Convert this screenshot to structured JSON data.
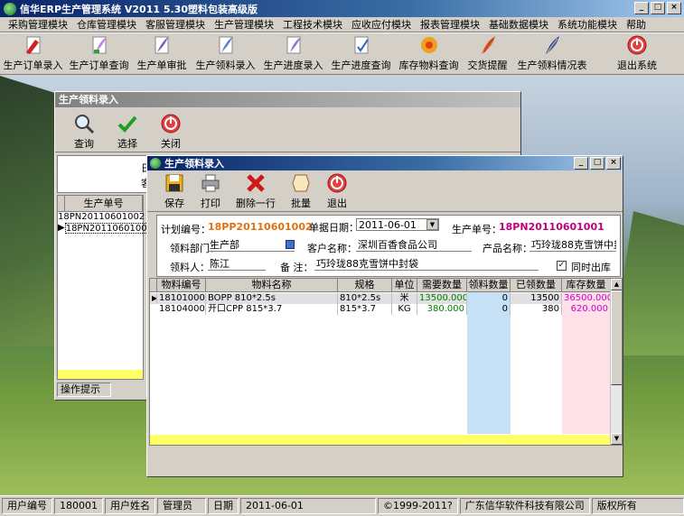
{
  "app": {
    "title": "信华ERP生产管理系统  V2011  5.30塑料包装高级版",
    "window_buttons": [
      "_",
      "□",
      "×"
    ]
  },
  "menu": [
    "采购管理模块",
    "仓库管理模块",
    "客服管理模块",
    "生产管理模块",
    "工程技术模块",
    "应收应付模块",
    "报表管理模块",
    "基础数据模块",
    "系统功能模块",
    "帮助"
  ],
  "toolbar": [
    {
      "label": "生产订单录入",
      "icon": "pen-doc-icon"
    },
    {
      "label": "生产订单查询",
      "icon": "feather-doc-icon"
    },
    {
      "label": "生产单审批",
      "icon": "quill-doc-icon"
    },
    {
      "label": "生产领料录入",
      "icon": "quill-doc-icon"
    },
    {
      "label": "生产进度录入",
      "icon": "feather-doc-icon"
    },
    {
      "label": "生产进度查询",
      "icon": "check-doc-icon"
    },
    {
      "label": "库存物料查询",
      "icon": "flower-icon"
    },
    {
      "label": "交货提醒",
      "icon": "quill-icon"
    },
    {
      "label": "生产领料情况表",
      "icon": "blue-feather-icon"
    },
    {
      "label": "退出系统",
      "icon": "exit-icon"
    }
  ],
  "bg_window": {
    "title": "生产领料录入",
    "tools": [
      "查询",
      "选择",
      "关闭"
    ],
    "list_header": "生产单号",
    "rows": [
      "18PN20110601002",
      "18PN20110601001"
    ],
    "hint": "操作提示",
    "partial_text_1": "日",
    "partial_text_2": "客"
  },
  "main_window": {
    "title": "生产领料录入",
    "tools": [
      "保存",
      "打印",
      "删除一行",
      "批量",
      "退出"
    ],
    "form": {
      "plan_no_label": "计划编号：",
      "plan_no": "18PP20110601002",
      "doc_date_label": "单据日期：",
      "doc_date": "2011-06-01",
      "prod_no_label": "生产单号：",
      "prod_no": "18PN20110601001",
      "dept_label": "领料部门：",
      "dept": "生产部",
      "customer_label": "客户名称：",
      "customer": "深圳百香食品公司",
      "product_label": "产品名称：",
      "product": "巧玲珑88克雪饼中封",
      "picker_label": "领料人：",
      "picker": "陈江",
      "note_label": "备  注：",
      "note": "巧玲珑88克雪饼中封袋",
      "same_time_label": "同时出库",
      "same_time_checked": "✓"
    },
    "grid": {
      "headers": [
        "物料编号",
        "物料名称",
        "规格",
        "单位",
        "需要数量",
        "领料数量",
        "已领数量",
        "库存数量"
      ],
      "rows": [
        [
          "1810100019",
          "BOPP 810*2.5s",
          "810*2.5s",
          "米",
          "13500.000",
          "0",
          "13500",
          "36500.000"
        ],
        [
          "1810400021",
          "开口CPP 815*3.7",
          "815*3.7",
          "KG",
          "380.000",
          "0",
          "380",
          "620.000"
        ]
      ]
    }
  },
  "status": [
    "用户编号",
    "180001",
    "用户姓名",
    "管理员",
    "日期",
    "2011-06-01",
    "©1999-2011?",
    "广东信华软件科技有限公司",
    "版权所有"
  ]
}
